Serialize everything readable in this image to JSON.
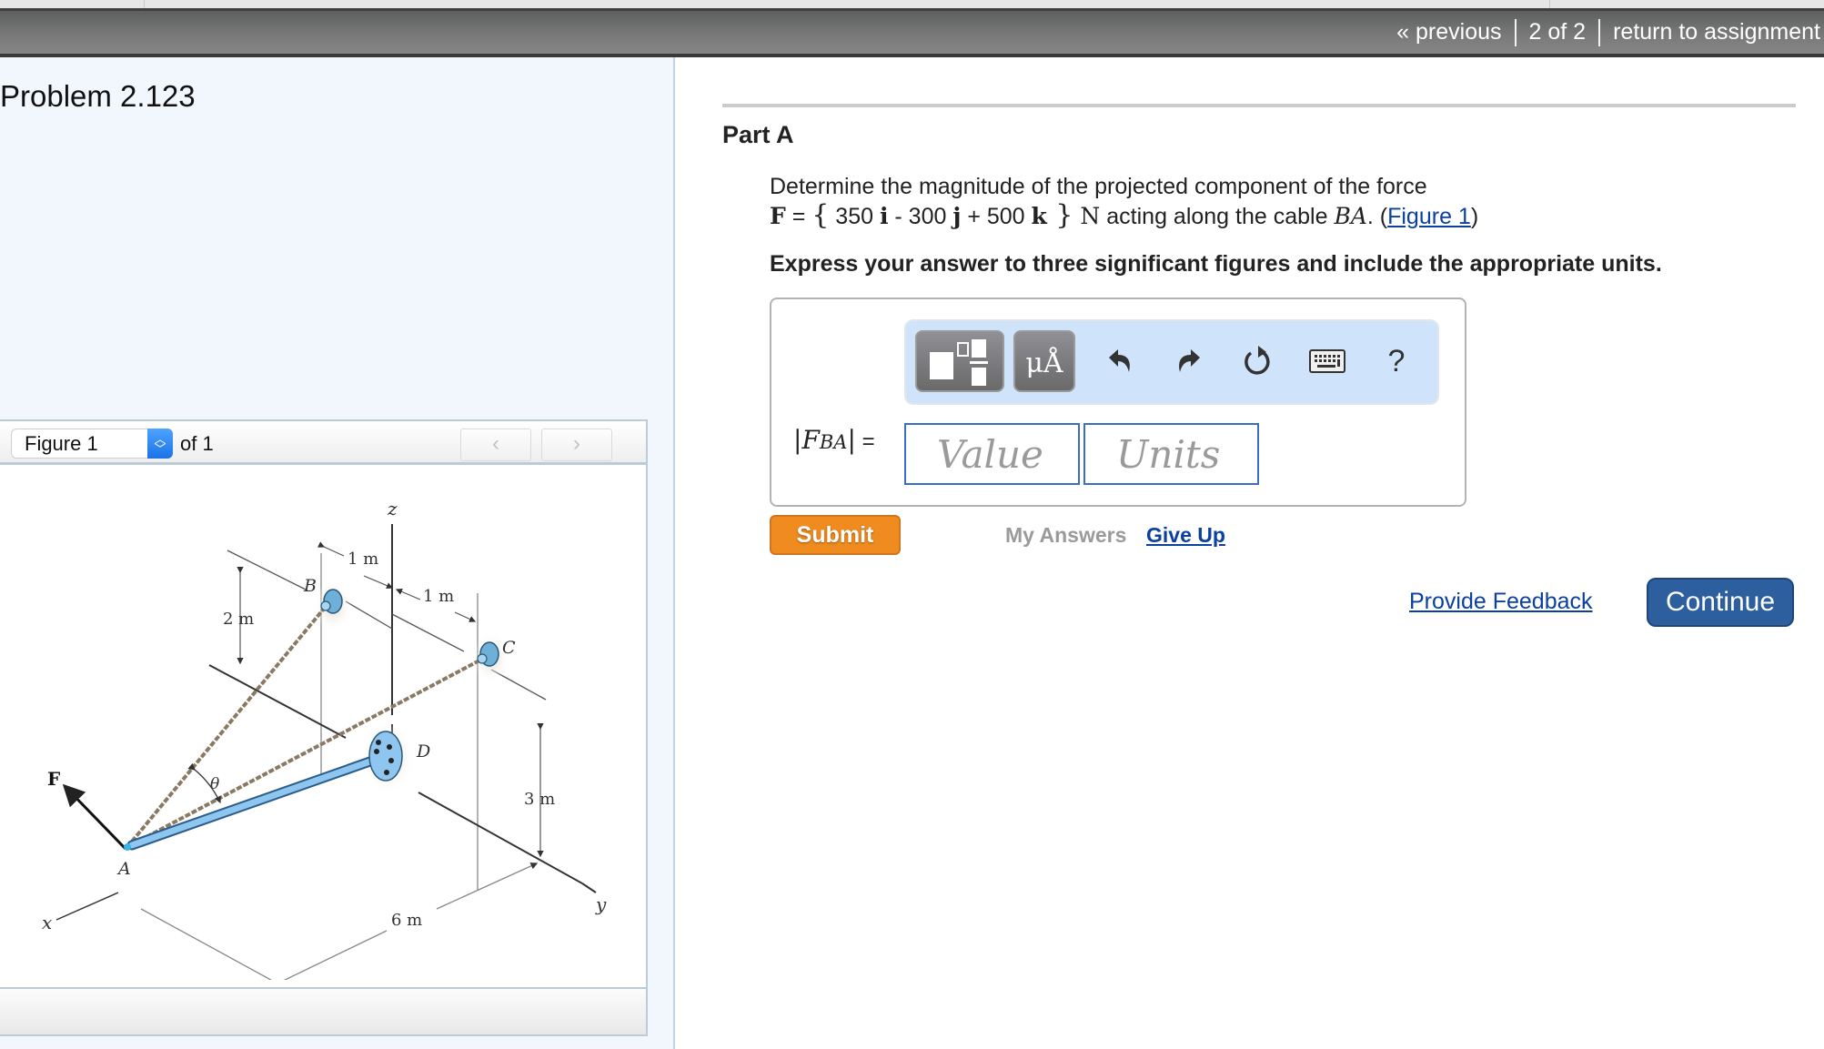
{
  "nav": {
    "previous": "« previous",
    "position": "2 of 2",
    "return": "return to assignment"
  },
  "problem": {
    "title": "Problem 2.123"
  },
  "figure_panel": {
    "selected": "Figure 1",
    "of_label": "of 1",
    "prev_icon": "‹",
    "next_icon": "›",
    "labels": {
      "z": "z",
      "x": "x",
      "y": "y",
      "A": "A",
      "B": "B",
      "C": "C",
      "D": "D",
      "F": "F",
      "theta": "θ",
      "dim_1m_a": "1 m",
      "dim_1m_b": "1 m",
      "dim_2m": "2 m",
      "dim_3m": "3 m",
      "dim_6m": "6 m"
    }
  },
  "part": {
    "title": "Part A",
    "question_line1": "Determine the magnitude of the projected component of the force",
    "force_symbol": "F",
    "equals": " = ",
    "open_brace": "{",
    "c1": " 350 ",
    "i": "i",
    "c2": " - 300 ",
    "j": "j",
    "c3": " + 500 ",
    "k": "k",
    "close_brace": " }",
    "unit": " N",
    "question_tail": " acting along the cable ",
    "cable": "BA",
    "period": ". (",
    "figure_link": "Figure 1",
    "close_paren": ")",
    "instruction": "Express your answer to three significant figures and include the appropriate units."
  },
  "answer": {
    "label_var": "F",
    "label_sub": "BA",
    "label_eq": " =",
    "value_placeholder": "Value",
    "units_placeholder": "Units",
    "toolbar": {
      "templates_icon": "templates-icon",
      "units_label": "μÅ",
      "undo_icon": "undo-icon",
      "redo_icon": "redo-icon",
      "reset_icon": "reset-icon",
      "keyboard_icon": "keyboard-icon",
      "help_label": "?"
    }
  },
  "actions": {
    "submit": "Submit",
    "my_answers": "My Answers",
    "give_up": "Give Up",
    "provide_feedback": "Provide Feedback",
    "continue": "Continue"
  },
  "colors": {
    "submit": "#ef8b1f",
    "continue": "#2d5f9e",
    "link": "#0b3fa0",
    "input_border": "#3b6dc7",
    "toolbar_bg": "#cfe4fb"
  }
}
